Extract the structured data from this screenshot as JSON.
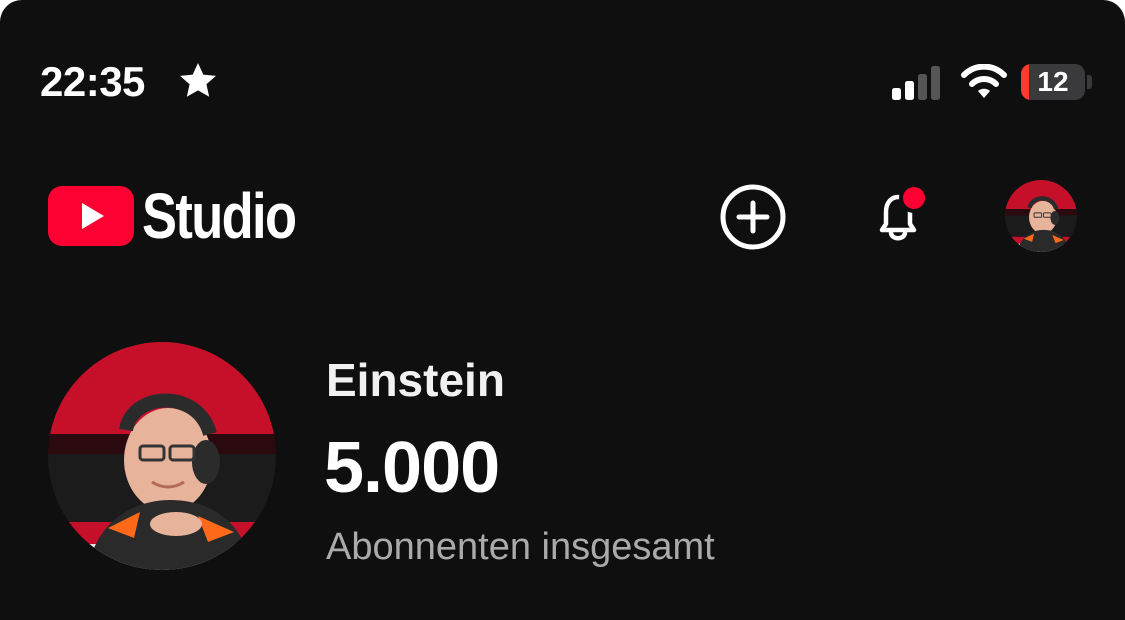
{
  "status_bar": {
    "time": "22:35",
    "focus_icon": "star-icon",
    "signal_icon": "cellular-signal-icon",
    "signal_bars_active": 2,
    "signal_bars_total": 4,
    "wifi_icon": "wifi-icon",
    "battery_percent": "12",
    "battery_level": 0.12,
    "battery_color": "#ff3b30"
  },
  "header": {
    "logo_icon": "youtube-play-icon",
    "logo_color": "#ff0033",
    "title": "Studio",
    "create_icon": "plus-circle-icon",
    "notifications_icon": "bell-icon",
    "notification_dot_color": "#ff0033",
    "account_icon": "avatar"
  },
  "channel": {
    "name": "Einstein",
    "subscriber_count": "5.000",
    "subscriber_label": "Abonnenten insgesamt"
  },
  "colors": {
    "background": "#0f0f0f",
    "text_primary": "#ffffff",
    "text_secondary": "#aaaaaa"
  }
}
